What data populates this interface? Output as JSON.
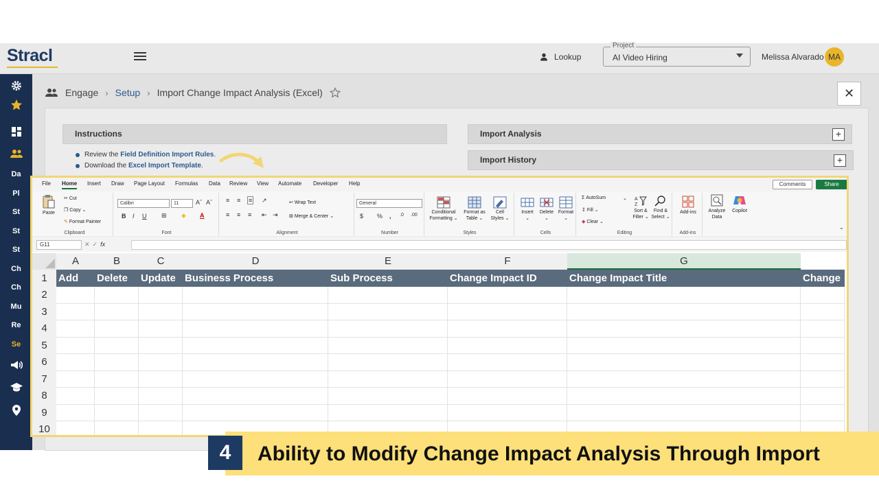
{
  "app": {
    "logo": "Stracl",
    "lookup_label": "Lookup",
    "project_legend": "Project",
    "project_value": "AI Video Hiring",
    "user_name": "Melissa Alvarado",
    "user_initials": "MA"
  },
  "sidebar": {
    "items": [
      {
        "icon": "gear-icon"
      },
      {
        "icon": "star-icon"
      },
      {
        "icon": "dashboard-icon"
      },
      {
        "icon": "people-icon",
        "active": true
      },
      {
        "label": "Da"
      },
      {
        "label": "Pl"
      },
      {
        "label": "St"
      },
      {
        "label": "St"
      },
      {
        "label": "St"
      },
      {
        "label": "Ch"
      },
      {
        "label": "Ch"
      },
      {
        "label": "Mu"
      },
      {
        "label": "Re"
      },
      {
        "label": "Se",
        "active": true
      },
      {
        "icon": "megaphone-icon"
      },
      {
        "icon": "graduation-cap-icon"
      },
      {
        "icon": "location-pin-icon"
      }
    ]
  },
  "breadcrumb": {
    "root": "Engage",
    "parent": "Setup",
    "current": "Import Change Impact Analysis (Excel)"
  },
  "panels": {
    "instructions": "Instructions",
    "import_analysis": "Import Analysis",
    "import_history": "Import History"
  },
  "instructions": {
    "line1_prefix": "Review the ",
    "line1_link": "Field Definition Import Rules",
    "line1_suffix": ".",
    "line2_prefix": "Download the ",
    "line2_link": "Excel Import Template",
    "line2_suffix": "."
  },
  "excel": {
    "tabs": [
      "File",
      "Home",
      "Insert",
      "Draw",
      "Page Layout",
      "Formulas",
      "Data",
      "Review",
      "View",
      "Automate",
      "Developer",
      "Help"
    ],
    "active_tab": "Home",
    "comments": "Comments",
    "share": "Share",
    "groups": {
      "clipboard": "Clipboard",
      "font": "Font",
      "alignment": "Alignment",
      "number": "Number",
      "styles": "Styles",
      "cells": "Cells",
      "editing": "Editing",
      "addins": "Add-ins"
    },
    "buttons": {
      "paste": "Paste",
      "cut": "Cut",
      "copy": "Copy",
      "format_painter": "Format Painter",
      "font_name": "Calibri",
      "font_size": "11",
      "wrap_text": "Wrap Text",
      "merge_center": "Merge & Center",
      "number_format": "General",
      "conditional_formatting_1": "Conditional",
      "conditional_formatting_2": "Formatting",
      "format_as_table_1": "Format as",
      "format_as_table_2": "Table",
      "cell_styles_1": "Cell",
      "cell_styles_2": "Styles",
      "insert": "Insert",
      "delete": "Delete",
      "format": "Format",
      "autosum": "AutoSum",
      "fill": "Fill",
      "clear": "Clear",
      "sort_filter_1": "Sort &",
      "sort_filter_2": "Filter",
      "find_select_1": "Find &",
      "find_select_2": "Select",
      "addins": "Add-ins",
      "analyze_data_1": "Analyze",
      "analyze_data_2": "Data",
      "copilot": "Copilot"
    },
    "name_box": "G11",
    "columns": [
      "A",
      "B",
      "C",
      "D",
      "E",
      "F",
      "G"
    ],
    "selected_column": "G",
    "header_row": [
      "Add",
      "Delete",
      "Update",
      "Business Process",
      "Sub Process",
      "Change Impact ID",
      "Change Impact Title",
      "Change"
    ],
    "row_numbers": [
      "1",
      "2",
      "3",
      "4",
      "5",
      "6",
      "7",
      "8",
      "9",
      "10"
    ]
  },
  "caption": {
    "number": "4",
    "text": "Ability to Modify Change Impact Analysis Through Import"
  },
  "colors": {
    "navy": "#1a2f4f",
    "gold": "#e8b52b",
    "caption_bg": "#fde07a",
    "excel_header": "#5a6b7d",
    "excel_green": "#1a7a41"
  }
}
